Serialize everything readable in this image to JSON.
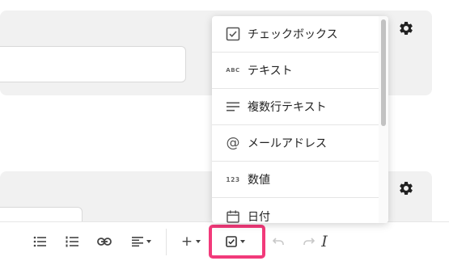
{
  "dropdown": {
    "items": [
      {
        "label": "チェックボックス",
        "icon": "checkbox-icon"
      },
      {
        "label": "テキスト",
        "icon": "abc-text-icon",
        "icon_text": "ABC"
      },
      {
        "label": "複数行テキスト",
        "icon": "multiline-text-icon"
      },
      {
        "label": "メールアドレス",
        "icon": "at-sign-icon",
        "icon_text": "@"
      },
      {
        "label": "数値",
        "icon": "number-icon",
        "icon_text": "123"
      },
      {
        "label": "日付",
        "icon": "calendar-icon"
      }
    ]
  },
  "toolbar": {
    "italic_glyph": "I",
    "plus_glyph": "+"
  },
  "colors": {
    "highlight": "#f23a7a",
    "card_background": "#f1f1f1"
  }
}
